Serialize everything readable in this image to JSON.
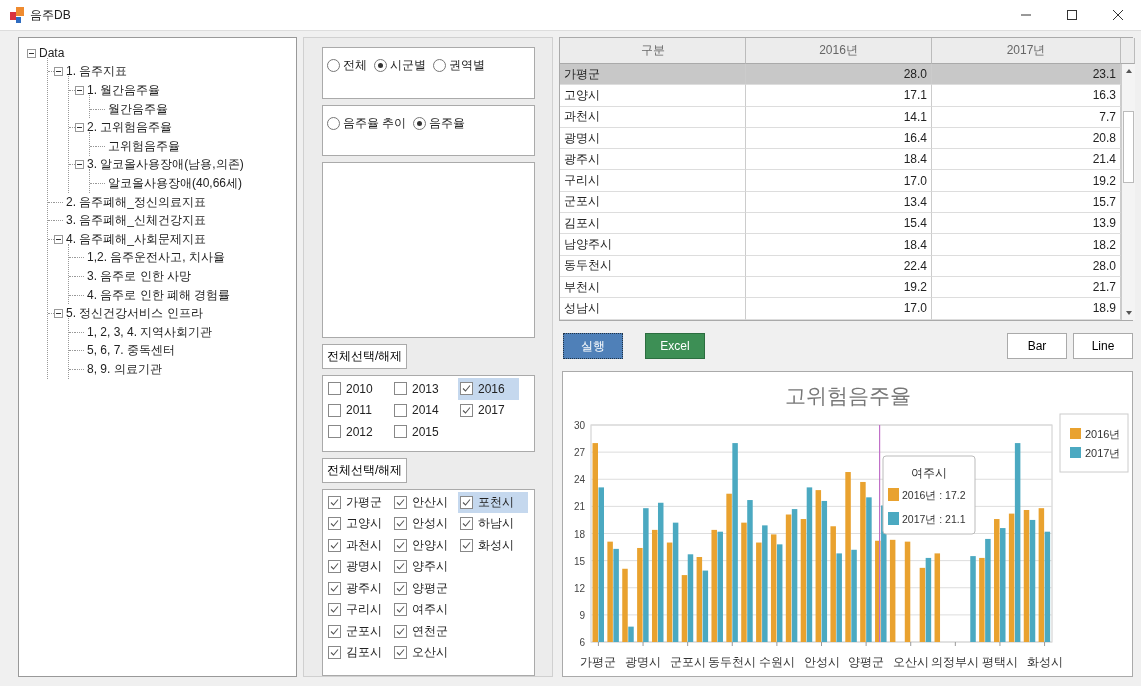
{
  "window": {
    "title": "음주DB"
  },
  "tree": {
    "label": "Data",
    "expanded": true,
    "children": [
      {
        "label": "1. 음주지표",
        "expanded": true,
        "children": [
          {
            "label": "1. 월간음주율",
            "expanded": true,
            "children": [
              {
                "label": "월간음주율"
              }
            ]
          },
          {
            "label": "2. 고위험음주율",
            "expanded": true,
            "children": [
              {
                "label": "고위험음주율"
              }
            ]
          },
          {
            "label": "3. 알코올사용장애(남용,의존)",
            "expanded": true,
            "children": [
              {
                "label": "알코올사용장애(40,66세)"
              }
            ]
          }
        ]
      },
      {
        "label": "2. 음주폐해_정신의료지표"
      },
      {
        "label": "3. 음주폐해_신체건강지표"
      },
      {
        "label": "4. 음주폐해_사회문제지표",
        "expanded": true,
        "children": [
          {
            "label": "1,2. 음주운전사고, 치사율"
          },
          {
            "label": "3. 음주로 인한 사망"
          },
          {
            "label": "4. 음주로 인한 폐해 경험률"
          }
        ]
      },
      {
        "label": "5. 정신건강서비스 인프라",
        "expanded": true,
        "children": [
          {
            "label": "1, 2, 3, 4. 지역사회기관"
          },
          {
            "label": "5, 6, 7. 중독센터"
          },
          {
            "label": "8, 9. 의료기관"
          }
        ]
      }
    ]
  },
  "region_options": [
    {
      "label": "전체",
      "selected": false
    },
    {
      "label": "시군별",
      "selected": true
    },
    {
      "label": "권역별",
      "selected": false
    }
  ],
  "measure_options": [
    {
      "label": "음주율 추이",
      "selected": false
    },
    {
      "label": "음주율",
      "selected": true
    }
  ],
  "year_toggle_button": "전체선택/해제",
  "years": [
    {
      "label": "2010",
      "checked": false,
      "selected": false
    },
    {
      "label": "2011",
      "checked": false,
      "selected": false
    },
    {
      "label": "2012",
      "checked": false,
      "selected": false
    },
    {
      "label": "2013",
      "checked": false,
      "selected": false
    },
    {
      "label": "2014",
      "checked": false,
      "selected": false
    },
    {
      "label": "2015",
      "checked": false,
      "selected": false
    },
    {
      "label": "2016",
      "checked": true,
      "selected": true
    },
    {
      "label": "2017",
      "checked": true,
      "selected": false
    }
  ],
  "region_toggle_button": "전체선택/해제",
  "regions": [
    {
      "label": "가평군",
      "checked": true,
      "selected": false
    },
    {
      "label": "고양시",
      "checked": true,
      "selected": false
    },
    {
      "label": "과천시",
      "checked": true,
      "selected": false
    },
    {
      "label": "광명시",
      "checked": true,
      "selected": false
    },
    {
      "label": "광주시",
      "checked": true,
      "selected": false
    },
    {
      "label": "구리시",
      "checked": true,
      "selected": false
    },
    {
      "label": "군포시",
      "checked": true,
      "selected": false
    },
    {
      "label": "김포시",
      "checked": true,
      "selected": false
    },
    {
      "label": "안산시",
      "checked": true,
      "selected": false
    },
    {
      "label": "안성시",
      "checked": true,
      "selected": false
    },
    {
      "label": "안양시",
      "checked": true,
      "selected": false
    },
    {
      "label": "양주시",
      "checked": true,
      "selected": false
    },
    {
      "label": "양평군",
      "checked": true,
      "selected": false
    },
    {
      "label": "여주시",
      "checked": true,
      "selected": false
    },
    {
      "label": "연천군",
      "checked": true,
      "selected": false
    },
    {
      "label": "오산시",
      "checked": true,
      "selected": false
    },
    {
      "label": "포천시",
      "checked": true,
      "selected": true
    },
    {
      "label": "하남시",
      "checked": true,
      "selected": false
    },
    {
      "label": "화성시",
      "checked": true,
      "selected": false
    }
  ],
  "table": {
    "columns": [
      "구분",
      "2016년",
      "2017년"
    ],
    "rows": [
      {
        "cells": [
          "가평군",
          "28.0",
          "23.1"
        ],
        "selected": true
      },
      {
        "cells": [
          "고양시",
          "17.1",
          "16.3"
        ],
        "selected": false
      },
      {
        "cells": [
          "과천시",
          "14.1",
          "7.7"
        ],
        "selected": false
      },
      {
        "cells": [
          "광명시",
          "16.4",
          "20.8"
        ],
        "selected": false
      },
      {
        "cells": [
          "광주시",
          "18.4",
          "21.4"
        ],
        "selected": false
      },
      {
        "cells": [
          "구리시",
          "17.0",
          "19.2"
        ],
        "selected": false
      },
      {
        "cells": [
          "군포시",
          "13.4",
          "15.7"
        ],
        "selected": false
      },
      {
        "cells": [
          "김포시",
          "15.4",
          "13.9"
        ],
        "selected": false
      },
      {
        "cells": [
          "남양주시",
          "18.4",
          "18.2"
        ],
        "selected": false
      },
      {
        "cells": [
          "동두천시",
          "22.4",
          "28.0"
        ],
        "selected": false
      },
      {
        "cells": [
          "부천시",
          "19.2",
          "21.7"
        ],
        "selected": false
      },
      {
        "cells": [
          "성남시",
          "17.0",
          "18.9"
        ],
        "selected": false
      }
    ]
  },
  "buttons": {
    "run": "실행",
    "excel": "Excel",
    "bar": "Bar",
    "line": "Line"
  },
  "chart": {
    "crosshair": true,
    "tooltip": {
      "title": "여주시",
      "entries": [
        "2016년 : 17.2",
        "2017년 : 21.1"
      ]
    },
    "chart_data": {
      "type": "bar",
      "title": "고위험음주율",
      "categories": [
        "가평군",
        null,
        null,
        "광명시",
        null,
        null,
        "군포시",
        null,
        null,
        "동두천시",
        null,
        null,
        "수원시",
        null,
        null,
        "안성시",
        null,
        null,
        "양평군",
        null,
        null,
        "오산시",
        null,
        null,
        "의정부시",
        null,
        null,
        "평택시",
        null,
        null,
        "화성시"
      ],
      "ylim": [
        6,
        30
      ],
      "yticks": [
        6,
        9,
        12,
        15,
        18,
        21,
        24,
        27,
        30
      ],
      "series": [
        {
          "name": "2016년",
          "color": "#e9a22f",
          "values": [
            28.0,
            17.1,
            14.1,
            16.4,
            18.4,
            17.0,
            13.4,
            15.4,
            18.4,
            22.4,
            19.2,
            17.0,
            17.9,
            20.1,
            19.6,
            22.8,
            18.8,
            24.8,
            23.7,
            17.2,
            17.3,
            17.1,
            14.2,
            15.8,
            null,
            null,
            15.3,
            19.6,
            20.2,
            20.6,
            20.8
          ]
        },
        {
          "name": "2017년",
          "color": "#4ba9c1",
          "values": [
            23.1,
            16.3,
            7.7,
            20.8,
            21.4,
            19.2,
            15.7,
            13.9,
            18.2,
            28.0,
            21.7,
            18.9,
            16.8,
            20.7,
            23.1,
            21.6,
            15.8,
            16.2,
            22.0,
            21.1,
            null,
            null,
            15.3,
            null,
            null,
            15.5,
            17.4,
            18.6,
            28.0,
            19.5,
            18.2
          ]
        }
      ],
      "grid": true,
      "legend": true
    }
  }
}
